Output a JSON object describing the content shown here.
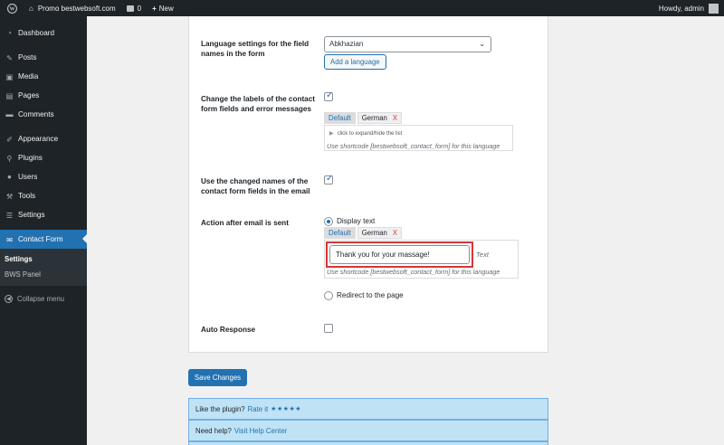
{
  "admin_bar": {
    "site_name": "Promo bestwebsoft.com",
    "comments_count": "0",
    "new_label": "New",
    "howdy": "Howdy, admin"
  },
  "sidebar": {
    "items": [
      {
        "label": "Dashboard",
        "icon": "dashboard-icon"
      },
      {
        "label": "Posts",
        "icon": "pin-icon"
      },
      {
        "label": "Media",
        "icon": "media-icon"
      },
      {
        "label": "Pages",
        "icon": "pages-icon"
      },
      {
        "label": "Comments",
        "icon": "comment-icon"
      },
      {
        "label": "Appearance",
        "icon": "brush-icon"
      },
      {
        "label": "Plugins",
        "icon": "plug-icon"
      },
      {
        "label": "Users",
        "icon": "user-icon"
      },
      {
        "label": "Tools",
        "icon": "wrench-icon"
      },
      {
        "label": "Settings",
        "icon": "sliders-icon"
      },
      {
        "label": "Contact Form",
        "icon": "envelope-icon"
      }
    ],
    "submenu": [
      "Settings",
      "BWS Panel"
    ],
    "collapse_label": "Collapse menu"
  },
  "form": {
    "language_label": "Language settings for the field names in the form",
    "language_select_value": "Abkhazian",
    "add_language_button": "Add a language",
    "change_labels_label": "Change the labels of the contact form fields and error messages",
    "change_labels_checked": true,
    "lang_tabs": [
      "Default",
      "German"
    ],
    "tab_close": "X",
    "expand_hint": "click to expand/hide the list",
    "shortcode_note": "Use shortcode [bestwebsoft_contact_form] for this language",
    "use_changed_label": "Use the changed names of the contact form fields in the email",
    "use_changed_checked": true,
    "action_label": "Action after email is sent",
    "display_text_label": "Display text",
    "display_text_value": "Thank you for your massage!",
    "text_suffix": "Text",
    "redirect_label": "Redirect to the page",
    "auto_response_label": "Auto Response",
    "auto_response_checked": false
  },
  "save_button": "Save Changes",
  "info": {
    "like_text": "Like the plugin?",
    "rate_link": "Rate it",
    "stars": "★★★★★",
    "help_text": "Need help?",
    "help_link": "Visit Help Center"
  },
  "colors": {
    "admin_dark": "#1d2327",
    "accent": "#2271b1",
    "highlight_red": "#d63638",
    "info_bg": "#bfe3f5"
  }
}
